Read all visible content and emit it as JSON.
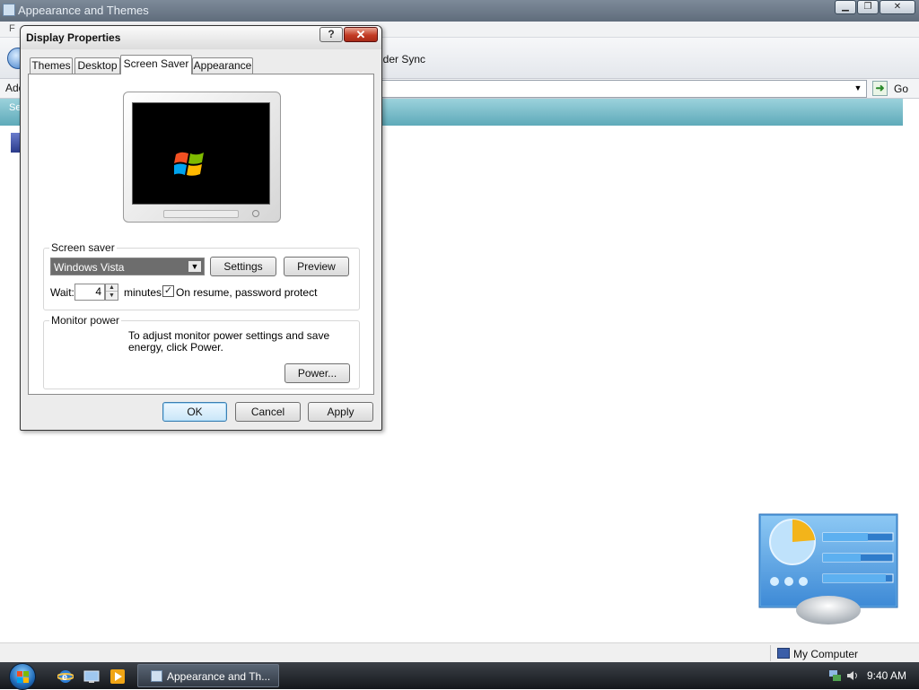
{
  "background_window": {
    "title": "Appearance and Themes",
    "menu_first": "F",
    "toolbar_text": "lder Sync",
    "address_label": "Add",
    "go_label": "Go",
    "band_text": "Se"
  },
  "dialog": {
    "title": "Display Properties",
    "help_glyph": "?",
    "close_glyph": "✕",
    "tabs": [
      {
        "label": "Themes"
      },
      {
        "label": "Desktop"
      },
      {
        "label": "Screen Saver"
      },
      {
        "label": "Appearance"
      }
    ],
    "active_tab": "Screen Saver",
    "screen_saver": {
      "group_label": "Screen saver",
      "selected": "Windows Vista",
      "settings_label": "Settings",
      "preview_label": "Preview",
      "wait_label": "Wait:",
      "wait_value": "4",
      "minutes_label": "minutes",
      "resume_checked": true,
      "resume_label": "On resume, password protect"
    },
    "monitor_power": {
      "group_label": "Monitor power",
      "description": "To adjust monitor power settings and save energy, click Power.",
      "power_button": "Power..."
    },
    "buttons": {
      "ok": "OK",
      "cancel": "Cancel",
      "apply": "Apply"
    }
  },
  "status_bar": {
    "location": "My Computer"
  },
  "taskbar": {
    "task_label": "Appearance and Th...",
    "clock": "9:40 AM"
  },
  "icons": [
    "start-orb-icon",
    "internet-explorer-icon",
    "show-desktop-icon",
    "media-player-icon",
    "control-panel-display-icon",
    "my-computer-icon",
    "network-tray-icon",
    "volume-tray-icon"
  ]
}
